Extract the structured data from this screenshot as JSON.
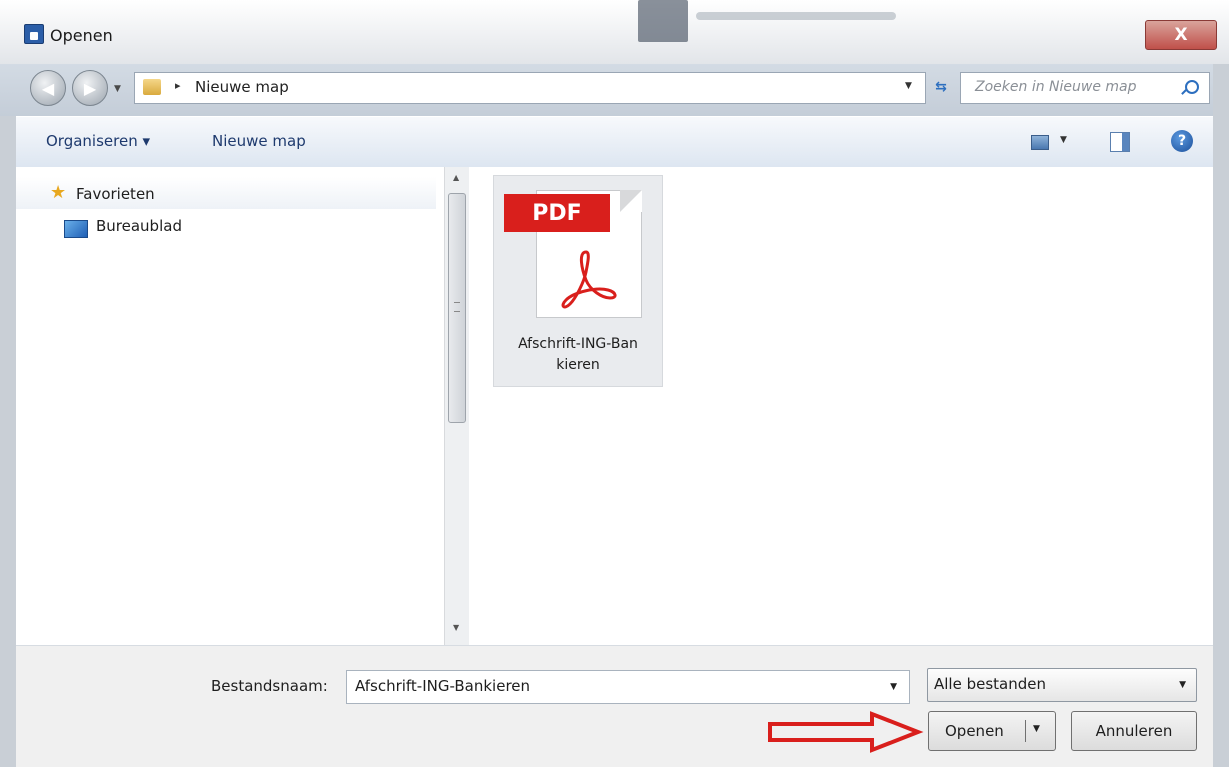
{
  "window": {
    "title": "Openen",
    "close_label": "X"
  },
  "address": {
    "path_separator": "▸",
    "current_folder": "Nieuwe map",
    "search_placeholder": "Zoeken in Nieuwe map"
  },
  "toolbar": {
    "organize_label": "Organiseren ▾",
    "new_folder_label": "Nieuwe map"
  },
  "nav": {
    "favorites_label": "Favorieten",
    "items": [
      {
        "label": "Bureaublad",
        "icon": "desktop-icon"
      }
    ]
  },
  "files": [
    {
      "name": "Afschrift-ING-Ban kieren",
      "icon": "pdf-file-icon",
      "badge": "PDF"
    }
  ],
  "footer": {
    "filename_label": "Bestandsnaam:",
    "filename_value": "Afschrift-ING-Bankieren",
    "filetype_value": "Alle bestanden",
    "open_label": "Openen",
    "cancel_label": "Annuleren"
  },
  "colors": {
    "annotation_arrow": "#d91f1c",
    "pdf_badge": "#d91f1c",
    "link_text": "#1e3a6e"
  }
}
